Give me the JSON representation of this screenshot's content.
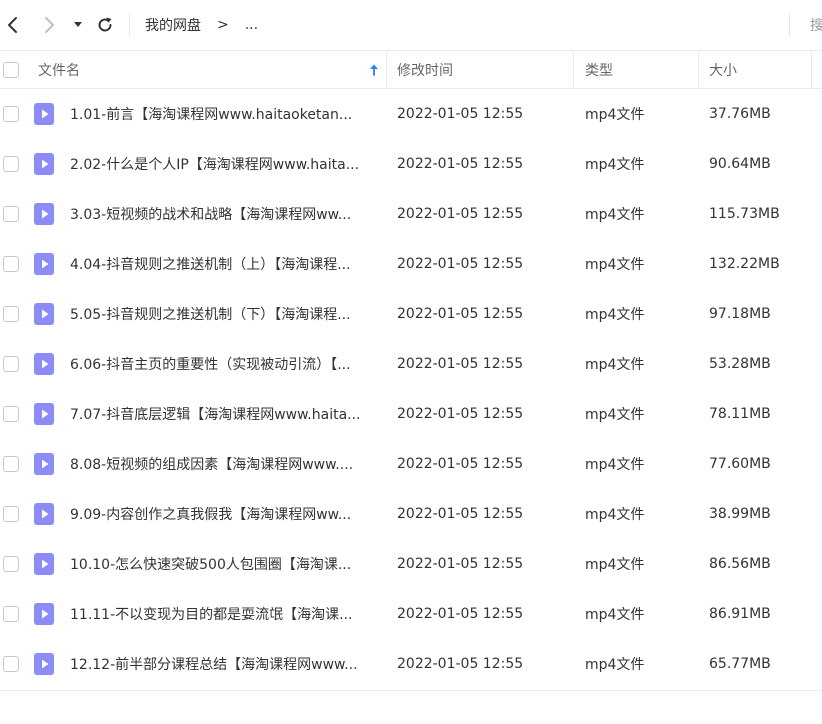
{
  "nav": {
    "breadcrumb_root": "我的网盘",
    "breadcrumb_sep": ">",
    "breadcrumb_more": "...",
    "search_label": "搜",
    "icons": {
      "back": "chevron-left-icon",
      "forward": "chevron-right-icon",
      "dropdown": "caret-down-icon",
      "refresh": "refresh-icon"
    }
  },
  "table": {
    "columns": {
      "name": "文件名",
      "time": "修改时间",
      "type": "类型",
      "size": "大小"
    },
    "sort_icon": "sort-up-arrow-icon",
    "rows": [
      {
        "name": "1.01-前言【海淘课程网www.haitaoketan...",
        "time": "2022-01-05 12:55",
        "type": "mp4文件",
        "size": "37.76MB"
      },
      {
        "name": "2.02-什么是个人IP【海淘课程网www.haita...",
        "time": "2022-01-05 12:55",
        "type": "mp4文件",
        "size": "90.64MB"
      },
      {
        "name": "3.03-短视频的战术和战略【海淘课程网ww...",
        "time": "2022-01-05 12:55",
        "type": "mp4文件",
        "size": "115.73MB"
      },
      {
        "name": "4.04-抖音规则之推送机制（上）【海淘课程...",
        "time": "2022-01-05 12:55",
        "type": "mp4文件",
        "size": "132.22MB"
      },
      {
        "name": "5.05-抖音规则之推送机制（下）【海淘课程...",
        "time": "2022-01-05 12:55",
        "type": "mp4文件",
        "size": "97.18MB"
      },
      {
        "name": "6.06-抖音主页的重要性（实现被动引流）【...",
        "time": "2022-01-05 12:55",
        "type": "mp4文件",
        "size": "53.28MB"
      },
      {
        "name": "7.07-抖音底层逻辑【海淘课程网www.haita...",
        "time": "2022-01-05 12:55",
        "type": "mp4文件",
        "size": "78.11MB"
      },
      {
        "name": "8.08-短视频的组成因素【海淘课程网www....",
        "time": "2022-01-05 12:55",
        "type": "mp4文件",
        "size": "77.60MB"
      },
      {
        "name": "9.09-内容创作之真我假我【海淘课程网ww...",
        "time": "2022-01-05 12:55",
        "type": "mp4文件",
        "size": "38.99MB"
      },
      {
        "name": "10.10-怎么快速突破500人包围圈【海淘课...",
        "time": "2022-01-05 12:55",
        "type": "mp4文件",
        "size": "86.56MB"
      },
      {
        "name": "11.11-不以变现为目的都是耍流氓【海淘课...",
        "time": "2022-01-05 12:55",
        "type": "mp4文件",
        "size": "86.91MB"
      },
      {
        "name": "12.12-前半部分课程总结【海淘课程网www...",
        "time": "2022-01-05 12:55",
        "type": "mp4文件",
        "size": "65.77MB"
      }
    ]
  },
  "colors": {
    "file_icon": "#8b8cf5",
    "sort_icon": "#2f7cf6",
    "border": "#ebebeb"
  }
}
